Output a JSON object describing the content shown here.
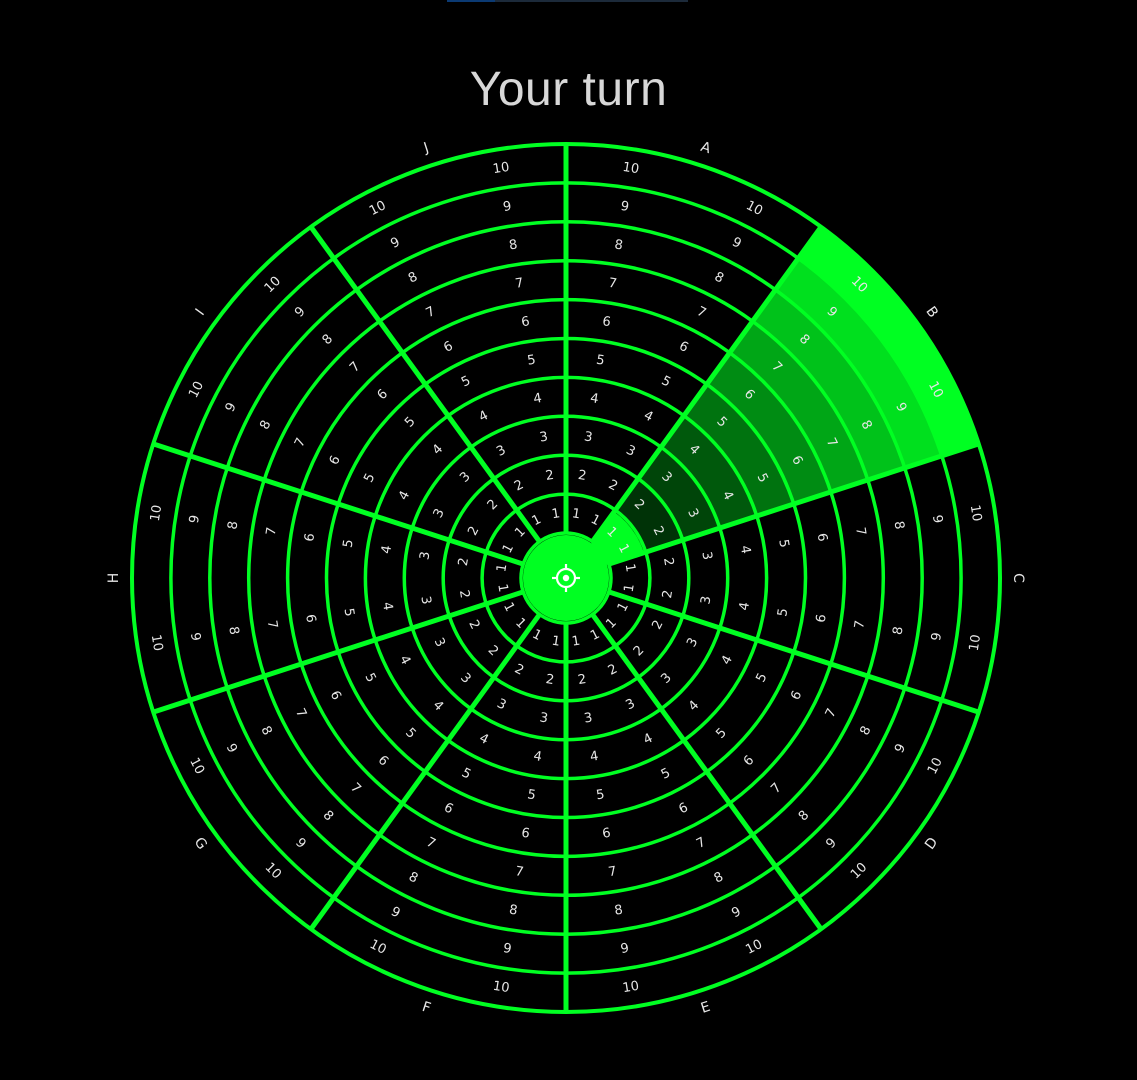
{
  "top_bar": {
    "tab_colors": [
      "#0b3a73",
      "#1c2a3a"
    ]
  },
  "status": {
    "title": "Your turn"
  },
  "board": {
    "sectors": [
      "A",
      "B",
      "C",
      "D",
      "E",
      "F",
      "G",
      "H",
      "I",
      "J"
    ],
    "rings": [
      "1",
      "2",
      "3",
      "4",
      "5",
      "6",
      "7",
      "8",
      "9",
      "10"
    ],
    "highlight": {
      "sectors": [
        "B"
      ],
      "active_sector": "B",
      "note": ""
    },
    "center_icon": "crosshair-icon",
    "colors": {
      "line": "#00ff22",
      "background": "#000000",
      "label": "#e6e6e6",
      "highlight": "#00ff22"
    }
  }
}
